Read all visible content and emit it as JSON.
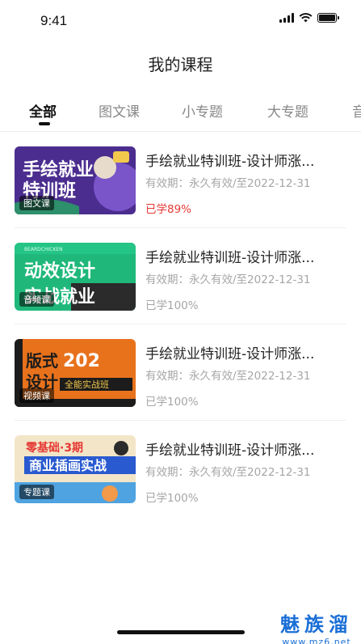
{
  "status_bar": {
    "time": "9:41"
  },
  "page_title": "我的课程",
  "tabs": [
    {
      "label": "全部",
      "active": true
    },
    {
      "label": "图文课",
      "active": false
    },
    {
      "label": "小专题",
      "active": false
    },
    {
      "label": "大专题",
      "active": false
    },
    {
      "label": "音",
      "active": false
    }
  ],
  "courses": [
    {
      "title": "手绘就业特训班-设计师涨...",
      "validity": "有效期：永久有效/至2022-12-31",
      "progress": "已学89%",
      "progress_highlight": true,
      "tag": "图文课",
      "thumb_text": "手绘就业特训班",
      "thumb_colors": [
        "#4b2d8f",
        "#6b3fb0"
      ]
    },
    {
      "title": "手绘就业特训班-设计师涨...",
      "validity": "有效期：永久有效/至2022-12-31",
      "progress": "已学100%",
      "progress_highlight": false,
      "tag": "音频课",
      "thumb_text": "动效设计实战就业",
      "thumb_colors": [
        "#1fb87a",
        "#33c990"
      ]
    },
    {
      "title": "手绘就业特训班-设计师涨...",
      "validity": "有效期：永久有效/至2022-12-31",
      "progress": "已学100%",
      "progress_highlight": false,
      "tag": "视频课",
      "thumb_text": "版式设计 全能实战班",
      "thumb_colors": [
        "#e8721c",
        "#f08a2a"
      ]
    },
    {
      "title": "手绘就业特训班-设计师涨...",
      "validity": "有效期：永久有效/至2022-12-31",
      "progress": "已学100%",
      "progress_highlight": false,
      "tag": "专题课",
      "thumb_text": "零基础·3期 商业插画实战",
      "thumb_colors": [
        "#f3e6c8",
        "#2a5ad0"
      ]
    }
  ],
  "watermark": {
    "main": "魅族溜",
    "sub": "www.mz6.net"
  },
  "colors": {
    "accent_red": "#e53935",
    "watermark_blue": "#1a6fd6"
  }
}
